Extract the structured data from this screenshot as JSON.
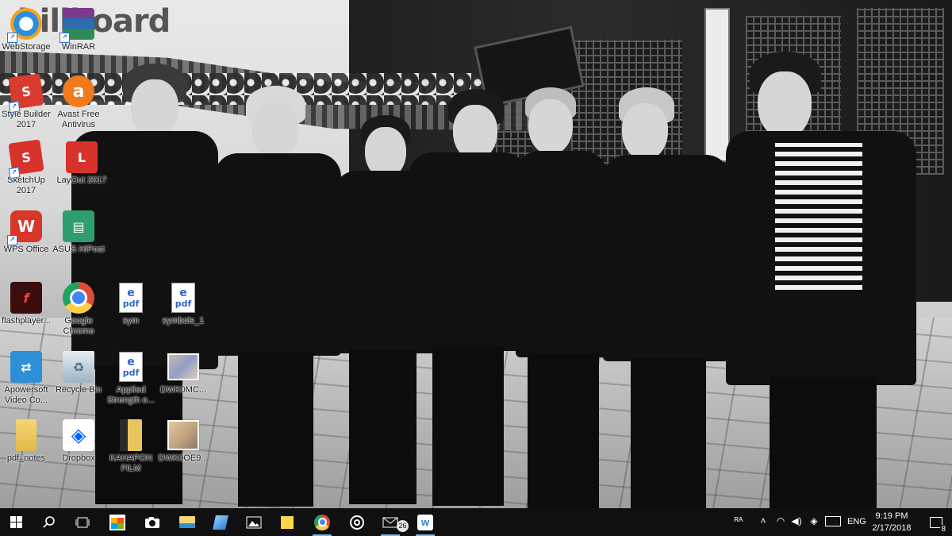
{
  "wallpaper": {
    "watermark": "billboard"
  },
  "desktop_icons": [
    {
      "id": "webstorage",
      "label": "WebStorage",
      "icon": "webstorage-icon",
      "color": "#f4a21b"
    },
    {
      "id": "winrar",
      "label": "WinRAR",
      "icon": "winrar-icon",
      "color": "#7b3a8c"
    },
    {
      "id": "stylebuilder",
      "label": "Style Builder 2017",
      "icon": "stylebuilder-icon",
      "color": "#d73a2f"
    },
    {
      "id": "avast",
      "label": "Avast Free Antivirus",
      "icon": "avast-icon",
      "color": "#f07a1e"
    },
    {
      "id": "sketchup",
      "label": "SketchUp 2017",
      "icon": "sketchup-icon",
      "color": "#d8322c"
    },
    {
      "id": "layout",
      "label": "LayOut 2017",
      "icon": "layout-icon",
      "color": "#d8322c"
    },
    {
      "id": "wps",
      "label": "WPS Office",
      "icon": "wps-icon",
      "color": "#d9362a"
    },
    {
      "id": "asushipost",
      "label": "ASUS HiPost",
      "icon": "asus-hipost-icon",
      "color": "#2f9e6e"
    },
    {
      "id": "flashplayer",
      "label": "flashplayer...",
      "icon": "flash-icon",
      "color": "#3c0d0d"
    },
    {
      "id": "chrome",
      "label": "Google Chrome",
      "icon": "chrome-icon",
      "color": "#dd4b39"
    },
    {
      "id": "sym",
      "label": "sym",
      "icon": "pdf-file-icon",
      "color": "#2c66c5"
    },
    {
      "id": "symbols1",
      "label": "symbols_1",
      "icon": "pdf-file-icon",
      "color": "#2c66c5"
    },
    {
      "id": "apowersoft",
      "label": "Apowersoft Video Co...",
      "icon": "apowersoft-icon",
      "color": "#2d8fd5"
    },
    {
      "id": "recyclebin",
      "label": "Recycle Bin",
      "icon": "recycle-bin-icon",
      "color": "#9ab"
    },
    {
      "id": "applied",
      "label": "Applied Strength o...",
      "icon": "pdf-file-icon",
      "color": "#2c66c5"
    },
    {
      "id": "dwkomc",
      "label": "DWK0MC...",
      "icon": "image-thumbnail-icon",
      "color": "#aab"
    },
    {
      "id": "pdfnotes",
      "label": "pdf_notes",
      "icon": "folder-icon",
      "color": "#e8c45a"
    },
    {
      "id": "dropbox",
      "label": "Dropbox",
      "icon": "dropbox-icon",
      "color": "#0061fe"
    },
    {
      "id": "kahapon",
      "label": "KAHAPON FILM",
      "icon": "folder-icon",
      "color": "#e8c45a"
    },
    {
      "id": "dwkooe9",
      "label": "DWK0OE9...",
      "icon": "image-thumbnail-icon",
      "color": "#aab"
    }
  ],
  "taskbar": {
    "buttons": [
      {
        "id": "start",
        "icon": "windows-start-icon"
      },
      {
        "id": "search",
        "icon": "search-icon"
      },
      {
        "id": "taskview",
        "icon": "task-view-icon"
      },
      {
        "id": "store",
        "icon": "store-icon"
      },
      {
        "id": "camera",
        "icon": "camera-icon"
      },
      {
        "id": "explorer",
        "icon": "file-explorer-icon"
      },
      {
        "id": "pin1",
        "icon": "blue-app-icon"
      },
      {
        "id": "photos",
        "icon": "photos-icon"
      },
      {
        "id": "sticky",
        "icon": "sticky-notes-icon"
      },
      {
        "id": "chrome",
        "icon": "chrome-icon"
      },
      {
        "id": "groove",
        "icon": "groove-music-icon"
      },
      {
        "id": "mail",
        "icon": "mail-icon"
      },
      {
        "id": "wps",
        "icon": "wps-icon"
      }
    ],
    "mail_badge": "26",
    "tray": {
      "language": "ENG",
      "time": "9:19 PM",
      "date": "2/17/2018",
      "notification_count": "8"
    }
  }
}
